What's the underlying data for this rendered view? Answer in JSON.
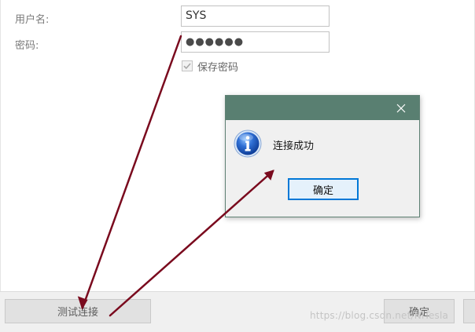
{
  "form": {
    "username_label": "用户名:",
    "username_value": "SYS",
    "password_label": "密码:",
    "password_value": "●●●●●●",
    "save_password_label": "保存密码",
    "save_password_checked": true
  },
  "toolbar": {
    "test_connection_label": "测试连接",
    "ok_label": "确定"
  },
  "dialog": {
    "message": "连接成功",
    "confirm_label": "确定",
    "title_color": "#597f71",
    "focus_color": "#0078d7"
  },
  "icons": {
    "dialog_icon": "info-icon",
    "close_icon": "close-icon",
    "checkbox_mark": "checkmark-icon"
  },
  "annotation_color": "#7a0a1e",
  "watermark": "https://blog.csdn.net/NiTesla"
}
